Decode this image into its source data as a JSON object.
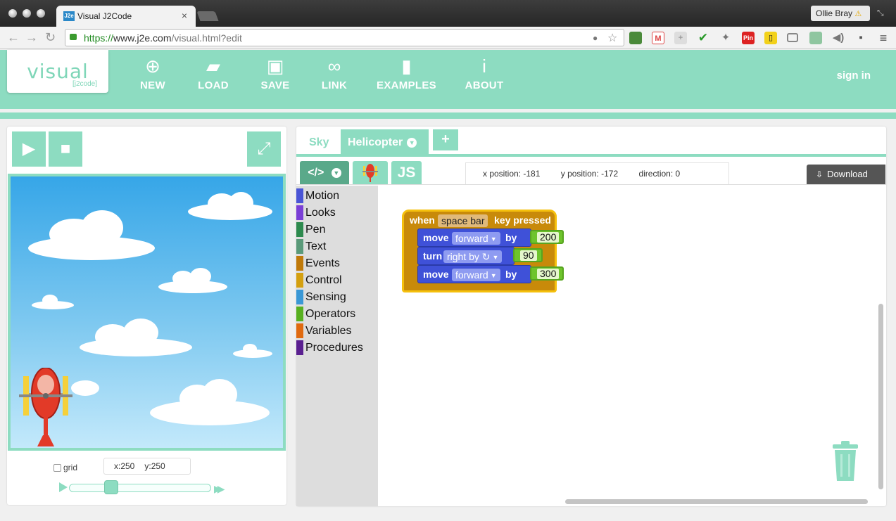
{
  "browser": {
    "tab_title": "Visual J2Code",
    "tab_favicon": "J2e",
    "tab_close": "×",
    "user_name": "Ollie Bray",
    "user_warning_glyph": "⚠",
    "url_scheme": "https://",
    "url_host": "www.j2e.com",
    "url_path": "/visual.html?edit",
    "back_glyph": "←",
    "forward_glyph": "→",
    "reload_glyph": "↻",
    "star_glyph": "☆",
    "bulb_glyph": "●",
    "menu_glyph": "≡",
    "extension_pin_label": "Pin"
  },
  "app": {
    "logo_main": "visual",
    "logo_sub": "[j2code]",
    "nav": [
      {
        "label": "NEW",
        "icon": "plus-circle-icon",
        "glyph": "⊕"
      },
      {
        "label": "LOAD",
        "icon": "folder-icon",
        "glyph": "▰"
      },
      {
        "label": "SAVE",
        "icon": "floppy-disk-icon",
        "glyph": "▣"
      },
      {
        "label": "LINK",
        "icon": "chain-link-icon",
        "glyph": "∞"
      },
      {
        "label": "EXAMPLES",
        "icon": "bookmark-icon",
        "glyph": "▮"
      },
      {
        "label": "ABOUT",
        "icon": "info-icon",
        "glyph": "i"
      }
    ],
    "sign_in": "sign in"
  },
  "stage": {
    "play_glyph": "▶",
    "stop_glyph": "■",
    "fullscreen_glyph": "⤢",
    "grid_label": "grid",
    "grid_checked": false,
    "mouse_x": "x:250",
    "mouse_y": "y:250",
    "speed_fast_glyph": "▶▶"
  },
  "editor": {
    "sprite_tabs": [
      {
        "label": "Sky",
        "active": false
      },
      {
        "label": "Helicopter",
        "active": true
      }
    ],
    "chevron_glyph": "▼",
    "add_sprite_label": "+",
    "mode_code_label": "</>",
    "mode_js_label": "JS",
    "info": {
      "x_position": "x position: -181",
      "y_position": "y position: -172",
      "direction": "direction: 0"
    },
    "download_label": "Download",
    "download_glyph": "⇩",
    "categories": [
      {
        "label": "Motion",
        "color": "#4a55d6"
      },
      {
        "label": "Looks",
        "color": "#7a3fd6"
      },
      {
        "label": "Pen",
        "color": "#2d8a4e"
      },
      {
        "label": "Text",
        "color": "#5a9a7a"
      },
      {
        "label": "Events",
        "color": "#c07a0a"
      },
      {
        "label": "Control",
        "color": "#d4a010"
      },
      {
        "label": "Sensing",
        "color": "#3a98d6"
      },
      {
        "label": "Operators",
        "color": "#58b020"
      },
      {
        "label": "Variables",
        "color": "#e06a10"
      },
      {
        "label": "Procedures",
        "color": "#5a2090"
      }
    ],
    "blocks": {
      "hat_when": "when",
      "hat_key": "space bar",
      "hat_suffix": "key pressed",
      "stmt1": {
        "verb": "move",
        "dir": "forward",
        "by": "by",
        "value": "200"
      },
      "stmt2": {
        "verb": "turn",
        "dir": "right by ↻",
        "value": "90"
      },
      "stmt3": {
        "verb": "move",
        "dir": "forward",
        "by": "by",
        "value": "300"
      }
    }
  },
  "colors": {
    "accent": "#8ddcc1",
    "event_block": "#c88a0a",
    "motion_block": "#3f51d8",
    "number_block": "#6ec42c"
  }
}
